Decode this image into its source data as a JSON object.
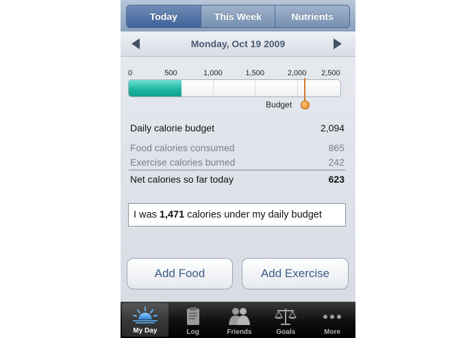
{
  "segments": [
    {
      "label": "Today",
      "active": true
    },
    {
      "label": "This Week",
      "active": false
    },
    {
      "label": "Nutrients",
      "active": false
    }
  ],
  "date_nav": {
    "date": "Monday, Oct 19 2009",
    "prev_icon": "left-triangle-arrow-icon",
    "next_icon": "right-triangle-arrow-icon"
  },
  "gauge": {
    "ticks": [
      "0",
      "500",
      "1,000",
      "1,500",
      "2,000",
      "2,500"
    ],
    "max": 2500,
    "net_value": 623,
    "budget_value": 2094,
    "budget_label": "Budget",
    "fill_color": "#1fb7a3",
    "budget_color": "#e5801d"
  },
  "stats": {
    "budget_label": "Daily calorie budget",
    "budget_value": "2,094",
    "food_label": "Food calories consumed",
    "food_value": "865",
    "exercise_label": "Exercise calories burned",
    "exercise_value": "242",
    "net_label": "Net calories so far today",
    "net_value": "623"
  },
  "summary": {
    "prefix": "I was ",
    "amount": "1,471",
    "suffix": " calories under my daily budget"
  },
  "actions": {
    "add_food": "Add Food",
    "add_exercise": "Add Exercise"
  },
  "tabs": [
    {
      "label": "My Day",
      "icon": "sunrise-icon",
      "active": true
    },
    {
      "label": "Log",
      "icon": "clipboard-icon",
      "active": false
    },
    {
      "label": "Friends",
      "icon": "people-icon",
      "active": false
    },
    {
      "label": "Goals",
      "icon": "scales-icon",
      "active": false
    },
    {
      "label": "More",
      "icon": "ellipsis-icon",
      "active": false
    }
  ]
}
